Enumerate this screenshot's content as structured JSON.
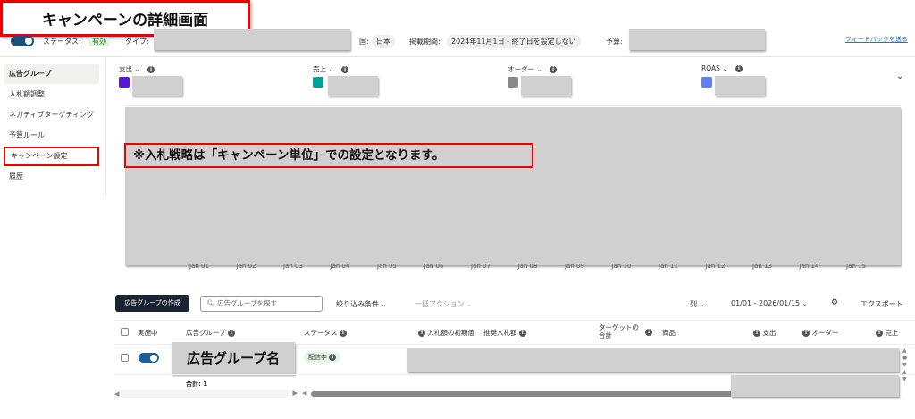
{
  "annotation_title": "キャンペーンの詳細画面",
  "header": {
    "status_label": "ステータス:",
    "status_value": "有効",
    "type_label": "タイプ:",
    "country_label": "国:",
    "country_value": "日本",
    "period_label": "掲載期間:",
    "period_value": "2024年11月1日 - 終了日を設定しない",
    "budget_label": "予算:",
    "feedback_link": "フィードバックを送る"
  },
  "sidebar": {
    "items": [
      {
        "label": "広告グループ",
        "active": true
      },
      {
        "label": "入札額調整"
      },
      {
        "label": "ネガティブターゲティング"
      },
      {
        "label": "予算ルール"
      },
      {
        "label": "キャンペーン設定",
        "highlighted": true
      },
      {
        "label": "履歴"
      }
    ]
  },
  "metrics": [
    {
      "label": "支出",
      "color": "#5b17d6"
    },
    {
      "label": "売上",
      "color": "#00a19a"
    },
    {
      "label": "オーダー",
      "color": "#888888"
    },
    {
      "label": "ROAS",
      "color": "#5f7dff"
    }
  ],
  "chart": {
    "annotation": "※入札戦略は「キャンペーン単位」での設定となります。",
    "x_ticks": [
      "Jan 01",
      "Jan 02",
      "Jan 03",
      "Jan 04",
      "Jan 05",
      "Jan 06",
      "Jan 07",
      "Jan 08",
      "Jan 09",
      "Jan 10",
      "Jan 11",
      "Jan 12",
      "Jan 13",
      "Jan 14",
      "Jan 15"
    ]
  },
  "toolbar": {
    "create_button": "広告グループの作成",
    "search_placeholder": "広告グループを探す",
    "filter": "絞り込み条件",
    "bulk_action": "一括アクション",
    "columns": "列",
    "date_range": "01/01 - 2026/01/15",
    "export": "エクスポート"
  },
  "table": {
    "headers": [
      "実施中",
      "広告グループ",
      "ステータス",
      "入札額の初期値",
      "推奨入札額",
      "ターゲットの合計",
      "商品",
      "支出",
      "オーダー",
      "売上"
    ],
    "rows": [
      {
        "name": "広告グループ名",
        "status": "配信中",
        "enabled": true
      }
    ],
    "total": "合計: 1"
  }
}
